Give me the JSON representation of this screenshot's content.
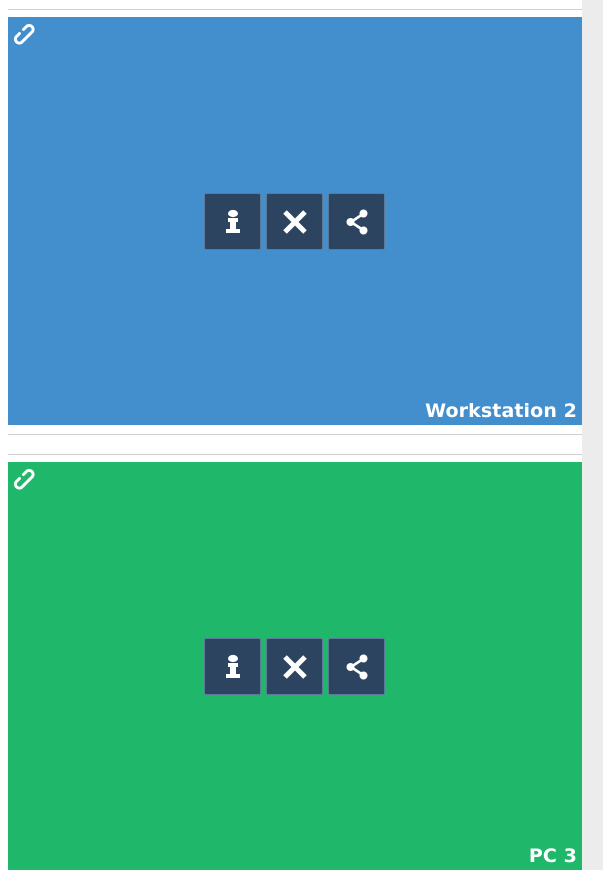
{
  "cards": [
    {
      "label": "Workstation 2",
      "color": "#438fce",
      "icons": {
        "link": "link-icon",
        "info": "info-icon",
        "remove": "close-icon",
        "share": "share-icon"
      }
    },
    {
      "label": "PC 3",
      "color": "#1fb86a",
      "icons": {
        "link": "link-icon",
        "info": "info-icon",
        "remove": "close-icon",
        "share": "share-icon"
      }
    }
  ],
  "colors": {
    "button_bg": "#2d4461",
    "button_border": "#5d7998",
    "label_text": "#ffffff",
    "scrollbar": "#ececec"
  }
}
